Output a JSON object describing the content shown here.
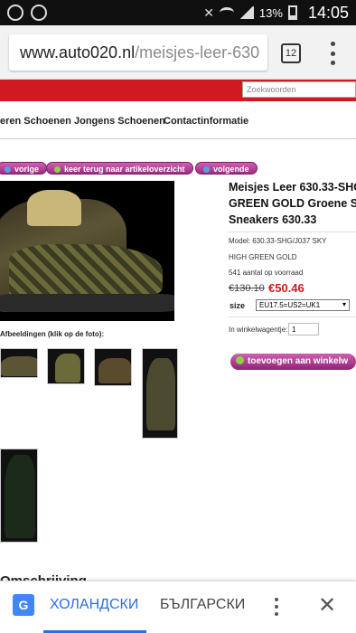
{
  "status": {
    "battery": "13%",
    "time": "14:05"
  },
  "browser": {
    "url_host": "www.auto020.nl",
    "url_path": "/meisjes-leer-630",
    "tab_count": "12"
  },
  "site": {
    "search_placeholder": "Zoekwoorden",
    "nav": [
      "eren Schoenen",
      "Jongens Schoenen",
      "Contactinformatie"
    ],
    "buttons": {
      "prev": "vorige",
      "back": "keer terug naar artikeloverzicht",
      "next": "volgende"
    }
  },
  "product": {
    "title_lines": [
      "Meisjes Leer 630.33-SHG",
      "GREEN GOLD Groene Sho",
      "Sneakers 630.33"
    ],
    "model": "Model: 630.33-SHG/J037 SKY",
    "model2": "HIGH GREEN GOLD",
    "stock": "541 aantal op voorraad",
    "old_price": "€130.10",
    "new_price": "€50.46",
    "size_label": "size",
    "size_value": "EU17.5=US2=UK1",
    "cart_label": "In winkelwagentje:",
    "qty": "1",
    "add_button": "toevoegen aan winkelw",
    "thumbs_header": "Afbeeldingen (klik op de foto):"
  },
  "bottom_cut_text": "Omschrijving",
  "translate": {
    "lang_active": "ХОЛАНДСКИ",
    "lang_other": "БЪЛГАРСКИ"
  },
  "colors": {
    "accent_red": "#d11920",
    "pill_magenta": "#b03a96",
    "translate_blue": "#2a6ee0"
  },
  "icons": [
    "call-icon",
    "chat-icon",
    "mute-icon",
    "wifi-icon",
    "signal-icon",
    "battery-icon",
    "google-translate-icon",
    "more-icon",
    "close-icon"
  ]
}
